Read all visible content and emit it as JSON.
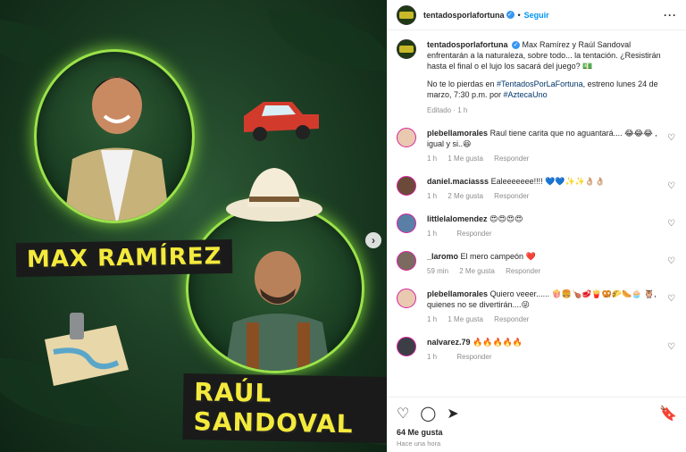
{
  "post": {
    "username": "tentadosporlafortuna",
    "follow_label": "Seguir",
    "more_label": "···",
    "nav_arrow": "›",
    "image_names": {
      "left": "MAX RAMÍREZ",
      "right": "RAÚL SANDOVAL"
    }
  },
  "caption": {
    "username": "tentadosporlafortuna",
    "text1": "Max Ramírez y Raúl Sandoval enfrentarán a la naturaleza, sobre todo... la tentación. ¿Resistirán hasta el final o el lujo los sacará del juego? 💵",
    "text2_pre": "No te lo pierdas en ",
    "hashtag": "#TentadosPorLaFortuna",
    "text2_mid": ", estreno lunes 24 de marzo, 7:30 p.m. por ",
    "mention": "#AztecaUno",
    "meta": "Editado · 1 h"
  },
  "comments": [
    {
      "user": "plebellamorales",
      "text": "Raul tiene carita que no aguantará.... 😂😂😂 , igual y si..😆",
      "time": "1 h",
      "likes": "1 Me gusta",
      "reply": "Responder",
      "avatar_color": "#e9c9b0"
    },
    {
      "user": "daniel.maciasss",
      "text": "Ealeeeeeee!!!! 💙💙✨✨👌🏼👌🏼",
      "time": "1 h",
      "likes": "2 Me gusta",
      "reply": "Responder",
      "avatar_color": "#6b4a3a"
    },
    {
      "user": "littlelalomendez",
      "text": "😍😍😍😍",
      "time": "1 h",
      "likes": "",
      "reply": "Responder",
      "avatar_color": "#5a7fa6"
    },
    {
      "user": "_laromo",
      "text": "El mero campeón ❤️",
      "time": "59 min",
      "likes": "2 Me gusta",
      "reply": "Responder",
      "avatar_color": "#7b6a5f"
    },
    {
      "user": "plebellamorales",
      "text": "Quiero veeer...... 🍿🍔🍗🥩🍟🥨🌮🌭🧁 🦉, quienes no se divertirán....😜",
      "time": "1 h",
      "likes": "1 Me gusta",
      "reply": "Responder",
      "avatar_color": "#e9c9b0"
    },
    {
      "user": "nalvarez.79",
      "text": "🔥🔥🔥🔥🔥",
      "time": "1 h",
      "likes": "",
      "reply": "Responder",
      "avatar_color": "#3b3f45"
    }
  ],
  "footer": {
    "likes": "64 Me gusta",
    "time": "Hace una hora"
  },
  "icons": {
    "heart": "♡",
    "comment": "◯",
    "share": "➤",
    "save": "🔖"
  },
  "colors": {
    "accent": "#0095f6",
    "name_yellow": "#f4ea3c",
    "glow": "#9be24a"
  }
}
